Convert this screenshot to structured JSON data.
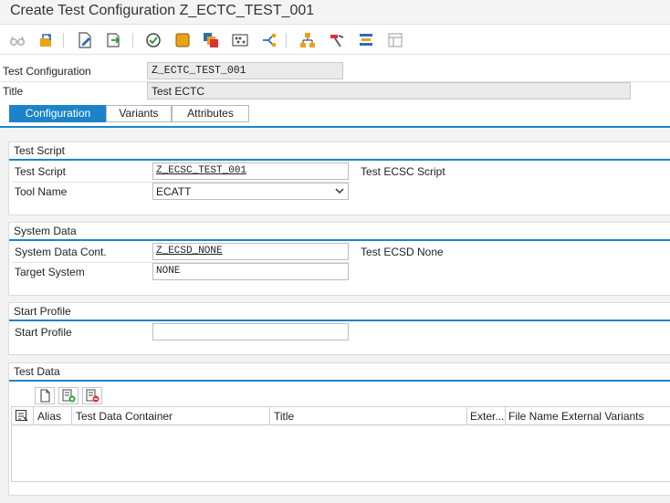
{
  "window": {
    "title": "Create Test Configuration Z_ECTC_TEST_001"
  },
  "toolbar": {
    "icons": [
      "glasses-icon",
      "transport-icon",
      "edit-document-icon",
      "export-document-icon",
      "check-icon",
      "object-icon",
      "copy-objects-icon",
      "abacus-icon",
      "distribute-icon",
      "hierarchy-icon",
      "tools-icon",
      "align-icon",
      "layout-icon"
    ]
  },
  "header": {
    "config_label": "Test Configuration",
    "config_value": "Z_ECTC_TEST_001",
    "title_label": "Title",
    "title_value": "Test ECTC"
  },
  "tabs": [
    {
      "label": "Configuration",
      "active": true
    },
    {
      "label": "Variants",
      "active": false
    },
    {
      "label": "Attributes",
      "active": false
    }
  ],
  "test_script": {
    "group_title": "Test Script",
    "script_label": "Test Script",
    "script_value": "Z_ECSC_TEST_001",
    "script_desc": "Test ECSC Script",
    "tool_label": "Tool Name",
    "tool_value": "ECATT"
  },
  "system_data": {
    "group_title": "System Data",
    "container_label": "System Data Cont.",
    "container_value": "Z_ECSD_NONE",
    "container_desc": "Test ECSD None",
    "target_label": "Target System",
    "target_value": "NONE"
  },
  "start_profile": {
    "group_title": "Start Profile",
    "profile_label": "Start Profile",
    "profile_value": ""
  },
  "test_data": {
    "group_title": "Test Data",
    "columns": [
      "Alias",
      "Test Data Container",
      "Title",
      "Exter...",
      "File Name External Variants"
    ]
  },
  "colors": {
    "accent": "#1b84c9",
    "background": "#f3f3f3"
  }
}
